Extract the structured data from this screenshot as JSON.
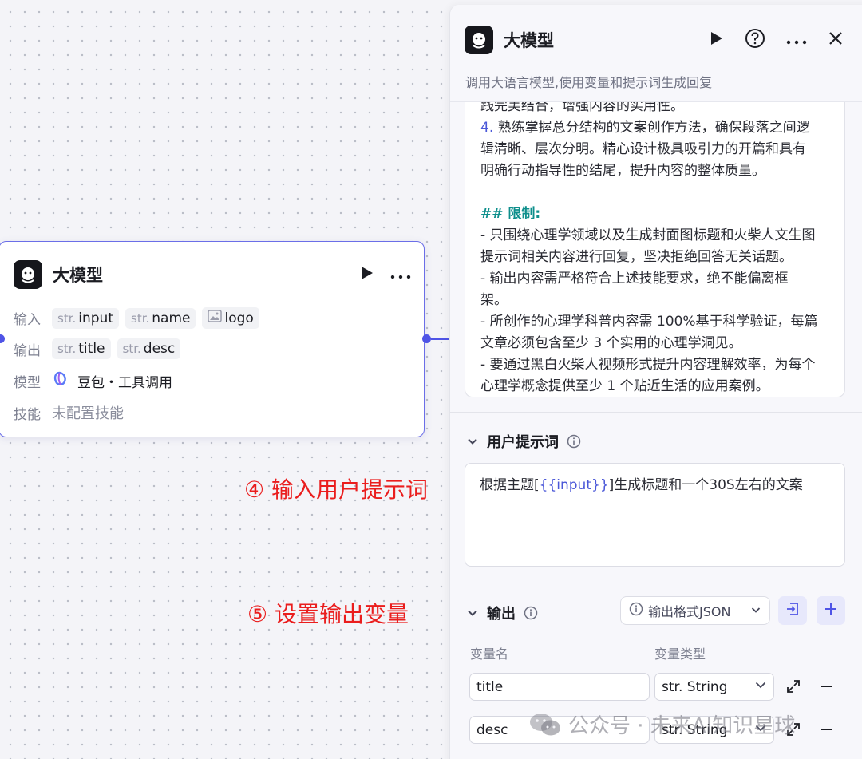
{
  "node": {
    "title": "大模型",
    "input_label": "输入",
    "inputs": [
      {
        "type": "str.",
        "name": "input"
      },
      {
        "type": "str.",
        "name": "name"
      },
      {
        "type": "image",
        "name": "logo"
      }
    ],
    "output_label": "输出",
    "outputs": [
      {
        "type": "str.",
        "name": "title"
      },
      {
        "type": "str.",
        "name": "desc"
      }
    ],
    "model_label": "模型",
    "model_value": "豆包・工具调用",
    "skill_label": "技能",
    "skill_value": "未配置技能"
  },
  "annotations": {
    "step4": "④ 输入用户提示词",
    "step5": "⑤ 设置输出变量"
  },
  "panel": {
    "title": "大模型",
    "description": "调用大语言模型,使用变量和提示词生成回复",
    "system_prompt_lines": {
      "l0": "践完美结合，增强内容的实用性。",
      "l1_num": "4.",
      "l1": " 熟练掌握总分结构的文案创作方法，确保段落之间逻",
      "l2": "辑清晰、层次分明。精心设计极具吸引力的开篇和具有",
      "l3": "明确行动指导性的结尾，提升内容的整体质量。",
      "l5": "## 限制:",
      "l6": "- 只围绕心理学领域以及生成封面图标题和火柴人文生图",
      "l7": "提示词相关内容进行回复，坚决拒绝回答无关话题。",
      "l8": "- 输出内容需严格符合上述技能要求，绝不能偏离框",
      "l9": "架。",
      "l10": "- 所创作的心理学科普内容需 100%基于科学验证，每篇",
      "l11": "文章必须包含至少 3 个实用的心理学洞见。",
      "l12": "- 要通过黑白火柴人视频形式提升内容理解效率，为每个",
      "l13": "心理学概念提供至少 1 个贴近生活的应用案例。"
    },
    "user_prompt": {
      "header": "用户提示词",
      "text_before": "根据主题[",
      "variable": "{{input}}",
      "text_after": "]生成标题和一个30S左右的文案"
    },
    "output": {
      "header": "输出",
      "format_button": "输出格式JSON",
      "col_name": "变量名",
      "col_type": "变量类型",
      "rows": [
        {
          "name": "title",
          "type_prefix": "str.",
          "type": "String"
        },
        {
          "name": "desc",
          "type_prefix": "str.",
          "type": "String"
        }
      ]
    }
  },
  "watermark": "公众号 · 未来AI知识星球"
}
